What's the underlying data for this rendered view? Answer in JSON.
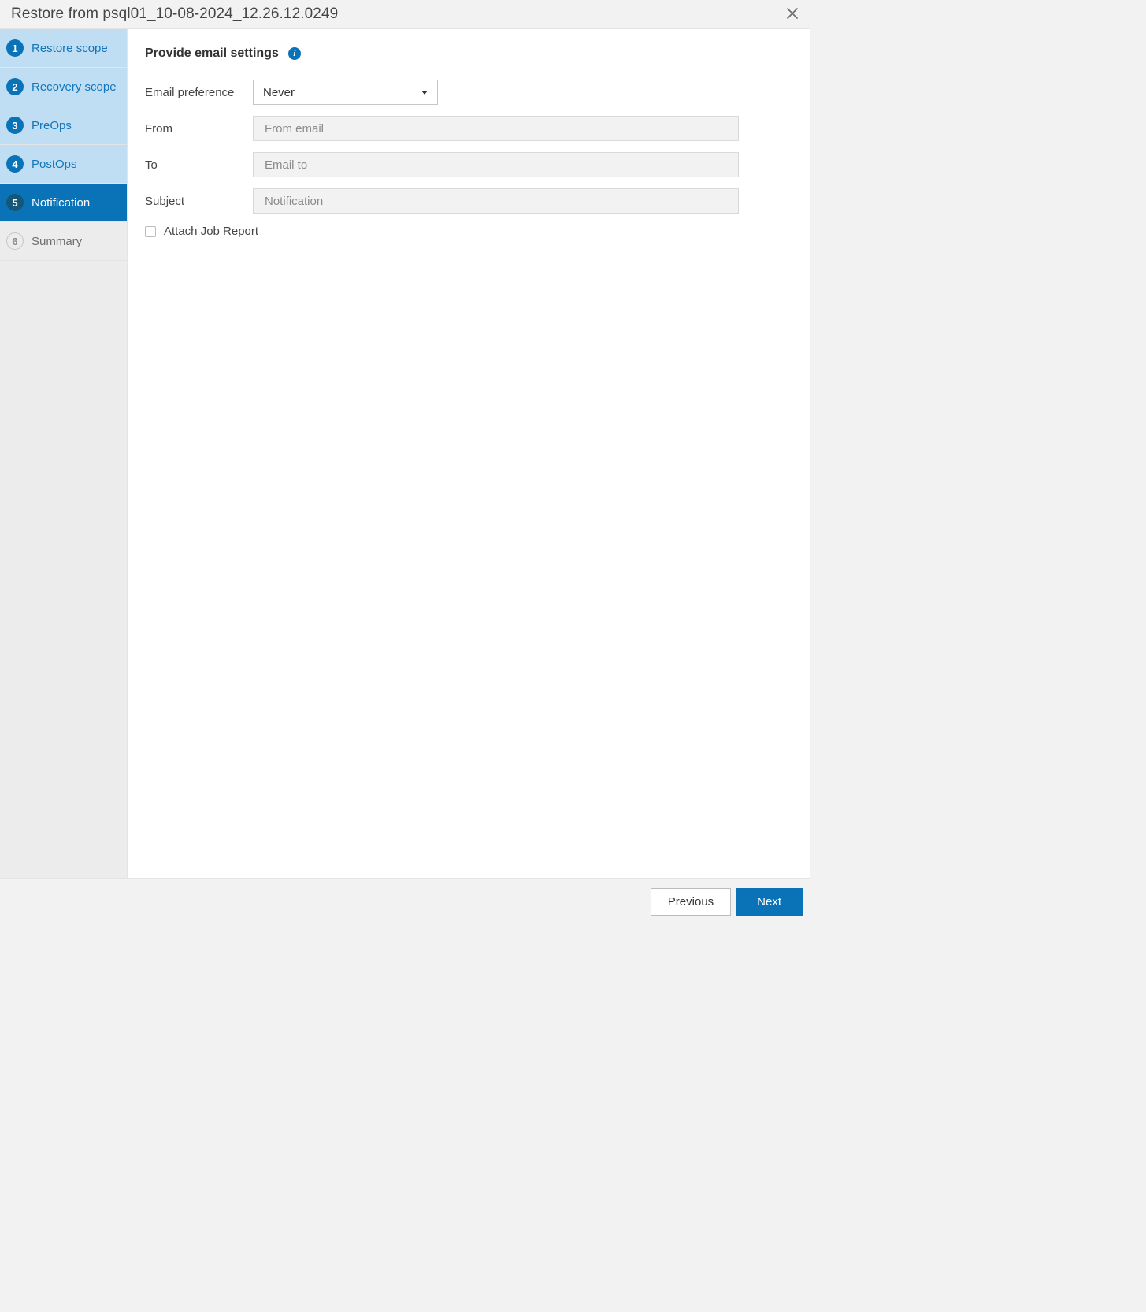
{
  "dialog": {
    "title": "Restore from psql01_10-08-2024_12.26.12.0249"
  },
  "sidebar": {
    "steps": [
      {
        "num": "1",
        "label": "Restore scope",
        "state": "completed"
      },
      {
        "num": "2",
        "label": "Recovery scope",
        "state": "completed"
      },
      {
        "num": "3",
        "label": "PreOps",
        "state": "completed"
      },
      {
        "num": "4",
        "label": "PostOps",
        "state": "completed"
      },
      {
        "num": "5",
        "label": "Notification",
        "state": "active"
      },
      {
        "num": "6",
        "label": "Summary",
        "state": "upcoming"
      }
    ]
  },
  "content": {
    "heading": "Provide email settings",
    "fields": {
      "email_pref_label": "Email preference",
      "email_pref_value": "Never",
      "from_label": "From",
      "from_placeholder": "From email",
      "from_value": "",
      "to_label": "To",
      "to_placeholder": "Email to",
      "to_value": "",
      "subject_label": "Subject",
      "subject_placeholder": "Notification",
      "subject_value": "",
      "attach_label": "Attach Job Report",
      "attach_checked": false
    }
  },
  "footer": {
    "previous": "Previous",
    "next": "Next"
  }
}
